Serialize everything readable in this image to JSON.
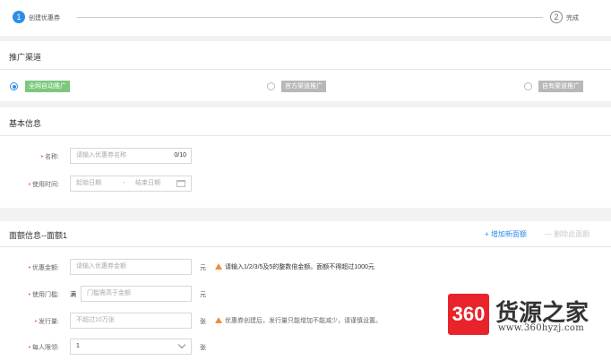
{
  "steps": [
    {
      "num": "1",
      "label": "创建优惠券"
    },
    {
      "num": "2",
      "label": "完成"
    }
  ],
  "channel": {
    "title": "推广渠道",
    "options": [
      {
        "label": "全网自动推广",
        "selected": true
      },
      {
        "label": "官方渠道推广",
        "selected": false
      },
      {
        "label": "自有渠道推广",
        "selected": false
      }
    ]
  },
  "basic": {
    "title": "基本信息",
    "name": {
      "label": "名称",
      "placeholder": "请输入优惠券名称",
      "counter": "0/10"
    },
    "time": {
      "label": "使用时间",
      "start_placeholder": "起始日期",
      "separator": "-",
      "end_placeholder": "结束日期"
    }
  },
  "amount": {
    "title": "面额信息--面额1",
    "add_label": "+ 增加新面额",
    "delete_label": "— 删除此面额",
    "value": {
      "label": "优惠金额",
      "placeholder": "请输入优惠券金额",
      "unit": "元",
      "hint": "请输入1/2/3/5及5的整数倍金额。面额不得超过1000元"
    },
    "threshold": {
      "label": "使用门槛",
      "prefix": "满",
      "placeholder": "门槛需高于金额",
      "unit": "元"
    },
    "issue": {
      "label": "发行量",
      "placeholder": "不超过10万张",
      "unit": "张",
      "hint": "优惠券创建后，发行量只能增加不能减少，请谨慎设置。"
    },
    "limit": {
      "label": "每人限领",
      "value": "1",
      "unit": "张"
    }
  },
  "watermark": {
    "logo": "360",
    "brand": "货源之家",
    "url": "www.360hyzj.com"
  },
  "colors": {
    "primary": "#2b8ee8",
    "selected_chip": "#7cc87c",
    "warning": "#f08c3c",
    "required": "#e85858",
    "logo_red": "#e8232b"
  }
}
